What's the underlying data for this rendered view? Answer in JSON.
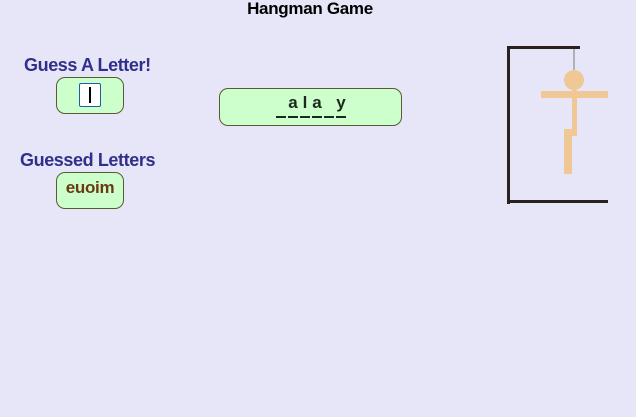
{
  "title": "Hangman Game",
  "guess_label": "Guess A Letter!",
  "letter_input": {
    "value": ""
  },
  "guessed_label": "Guessed Letters",
  "guessed_letters": "euoim",
  "word_display": [
    {
      "char": ""
    },
    {
      "char": "a"
    },
    {
      "char": "l"
    },
    {
      "char": "a"
    },
    {
      "char": ""
    },
    {
      "char": "y"
    }
  ],
  "colors": {
    "background": "#e6e6f8",
    "box_fill": "#ccffcc",
    "label_color": "#30308c",
    "guessed_color": "#6b3a10",
    "figure_color": "#f0c896",
    "gallows_color": "#2a2020"
  }
}
